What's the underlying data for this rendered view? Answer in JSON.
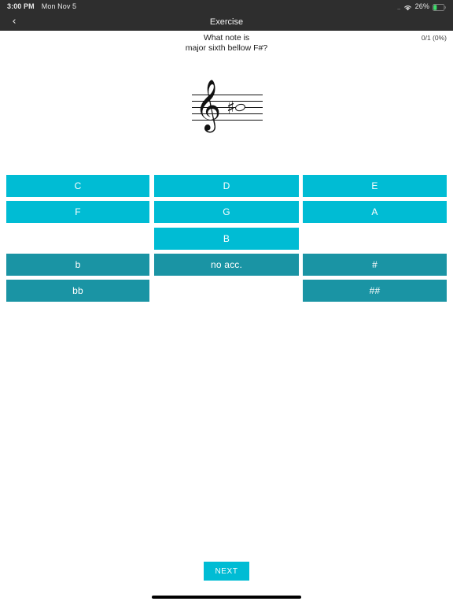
{
  "status_bar": {
    "time": "3:00 PM",
    "date": "Mon Nov 5",
    "signal_dots": "....",
    "wifi_icon": "wifi-icon",
    "battery_percent": "26%",
    "battery_icon": "battery-icon"
  },
  "nav": {
    "back_icon": "‹",
    "title": "Exercise"
  },
  "question": {
    "line1": "What note is",
    "line2": "major sixth bellow F#?",
    "score": "0/1 (0%)"
  },
  "staff": {
    "clef_glyph": "𝄞",
    "clef_name": "treble-clef",
    "accidental_glyph": "♯",
    "accidental_name": "sharp-sign",
    "note_name": "whole-note"
  },
  "answers": {
    "note_buttons": [
      {
        "label": "C",
        "col": "col-l",
        "row": "row1"
      },
      {
        "label": "D",
        "col": "col-c",
        "row": "row1"
      },
      {
        "label": "E",
        "col": "col-r",
        "row": "row1"
      },
      {
        "label": "F",
        "col": "col-l",
        "row": "row2"
      },
      {
        "label": "G",
        "col": "col-c",
        "row": "row2"
      },
      {
        "label": "A",
        "col": "col-r",
        "row": "row2"
      },
      {
        "label": "B",
        "col": "col-c",
        "row": "row3"
      }
    ],
    "accidental_buttons": [
      {
        "label": "b",
        "col": "col-l",
        "row": "row4"
      },
      {
        "label": "no acc.",
        "col": "col-c",
        "row": "row4"
      },
      {
        "label": "#",
        "col": "col-r",
        "row": "row4"
      },
      {
        "label": "bb",
        "col": "col-l",
        "row": "row5"
      },
      {
        "label": "##",
        "col": "col-r",
        "row": "row5"
      }
    ]
  },
  "footer": {
    "next_label": "NEXT"
  },
  "colors": {
    "accent": "#00bcd4",
    "accent_dark": "#1a94a4",
    "bar": "#2e2e2e",
    "text_dark": "#1a1a1a",
    "page_bg": "#ffffff"
  }
}
